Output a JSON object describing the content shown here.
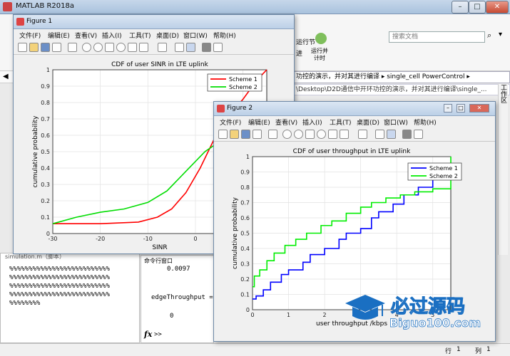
{
  "main": {
    "title": "MATLAB R2018a",
    "search_placeholder": "搜索文档",
    "ribbon_run_section": "运行节",
    "ribbon_run_timed_line1": "运行并",
    "ribbon_run_timed_line2": "计时",
    "ribbon_advance": "进",
    "address_text": "功控的演示，并对其进行编译 ▸ single_cell PowerControl ▸",
    "address_text2": "\\Desktop\\D2D通信中开环功控的演示，并对其进行编译\\single_...",
    "right_tab": "工作区",
    "workspace_label": "simulation.m（脚本）",
    "hash_lines": [
      "%%%%%%%%%%%%%%%%%%%%%%%%%%",
      "%%%%%%%%%%%%%%%%%%%%%%%%%%",
      "%%%%%%%%%%%%%%%%%%%%%%%%%%",
      "%%%%%%%%%%%%%%%%%%%%%%%%%%",
      "%%%%%%%%"
    ],
    "command_window_title": "命令行窗口",
    "cmd_value1": "0.0097",
    "cmd_var": "edgeThroughput =",
    "cmd_value2": "0",
    "fx": "fx",
    "prompt": ">>",
    "status_row_label": "行",
    "status_row": "1",
    "status_col_label": "列",
    "status_col": "1"
  },
  "menu": [
    "文件(F)",
    "编辑(E)",
    "查看(V)",
    "插入(I)",
    "工具(T)",
    "桌面(D)",
    "窗口(W)",
    "帮助(H)"
  ],
  "figure1": {
    "title": "Figure 1"
  },
  "figure2": {
    "title": "Figure 2"
  },
  "watermark": {
    "text1": "必过源码",
    "text2": "Biguo100.com"
  },
  "colors": {
    "scheme1": "#ff0000",
    "scheme2": "#00dd00",
    "scheme1b": "#0000ff",
    "scheme2b": "#00ee00"
  },
  "chart_data": [
    {
      "type": "line",
      "title": "CDF of user SINR in LTE uplink",
      "xlabel": "SINR",
      "ylabel": "cumulative probability",
      "xlim": [
        -30,
        15
      ],
      "ylim": [
        0,
        1
      ],
      "xticks": [
        -30,
        -20,
        -10,
        0,
        10
      ],
      "yticks": [
        0,
        0.1,
        0.2,
        0.3,
        0.4,
        0.5,
        0.6,
        0.7,
        0.8,
        0.9,
        1
      ],
      "grid": true,
      "legend": "top-right",
      "series": [
        {
          "name": "Scheme 1",
          "x": [
            -30,
            -20,
            -12,
            -8,
            -5,
            -2,
            1,
            4,
            7,
            10,
            12,
            14,
            15
          ],
          "y": [
            0.06,
            0.06,
            0.07,
            0.1,
            0.15,
            0.25,
            0.4,
            0.58,
            0.72,
            0.82,
            0.9,
            0.97,
            1.0
          ]
        },
        {
          "name": "Scheme 2",
          "x": [
            -30,
            -25,
            -20,
            -15,
            -10,
            -6,
            -2,
            2,
            6,
            10,
            13,
            15
          ],
          "y": [
            0.06,
            0.1,
            0.13,
            0.15,
            0.19,
            0.26,
            0.38,
            0.5,
            0.58,
            0.65,
            0.68,
            0.7
          ]
        }
      ]
    },
    {
      "type": "line",
      "title": "CDF of user throughput in LTE uplink",
      "xlabel": "user throughput /kbps",
      "ylabel": "cumulative probability",
      "xlim": [
        0,
        5.5
      ],
      "ylim": [
        0,
        1
      ],
      "xticks": [
        0,
        1,
        2,
        3,
        4,
        5
      ],
      "yticks": [
        0,
        0.1,
        0.2,
        0.3,
        0.4,
        0.5,
        0.6,
        0.7,
        0.8,
        0.9,
        1
      ],
      "grid": true,
      "legend": "top-right",
      "series": [
        {
          "name": "Scheme 1",
          "x": [
            0,
            0.1,
            0.3,
            0.5,
            0.8,
            1.0,
            1.4,
            1.6,
            2.0,
            2.4,
            2.6,
            3.0,
            3.3,
            3.5,
            3.9,
            4.2,
            4.6,
            5.0,
            5.5
          ],
          "y": [
            0.07,
            0.09,
            0.13,
            0.18,
            0.23,
            0.26,
            0.31,
            0.36,
            0.4,
            0.46,
            0.5,
            0.53,
            0.6,
            0.64,
            0.69,
            0.75,
            0.8,
            0.86,
            0.88
          ]
        },
        {
          "name": "Scheme 2",
          "x": [
            0,
            0.05,
            0.2,
            0.4,
            0.6,
            0.9,
            1.2,
            1.5,
            1.9,
            2.2,
            2.6,
            3.0,
            3.3,
            3.7,
            4.1,
            4.5,
            5.0,
            5.5
          ],
          "y": [
            0.15,
            0.22,
            0.26,
            0.32,
            0.37,
            0.42,
            0.46,
            0.5,
            0.55,
            0.58,
            0.63,
            0.67,
            0.7,
            0.73,
            0.75,
            0.77,
            0.79,
            1.0
          ]
        }
      ]
    }
  ]
}
